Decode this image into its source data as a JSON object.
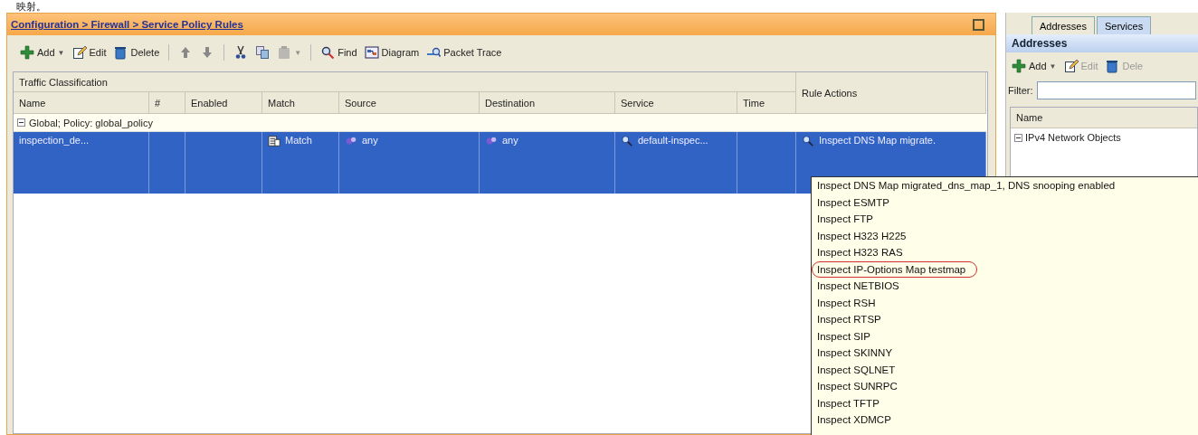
{
  "caption": "映射。",
  "panel": {
    "breadcrumb": "Configuration > Firewall > Service Policy Rules",
    "toolbar": [
      {
        "kind": "button",
        "label": "Add",
        "caret": "▼",
        "disabled": false
      },
      {
        "kind": "button",
        "label": "Edit",
        "disabled": false
      },
      {
        "kind": "button",
        "label": "Delete",
        "disabled": false
      },
      {
        "kind": "separator"
      },
      {
        "kind": "button",
        "disabled": false
      },
      {
        "kind": "button",
        "disabled": false
      },
      {
        "kind": "separator"
      },
      {
        "kind": "button",
        "disabled": false
      },
      {
        "kind": "button",
        "disabled": false
      },
      {
        "kind": "button",
        "caret": "▼",
        "disabled": true
      },
      {
        "kind": "separator"
      },
      {
        "kind": "button",
        "label": "Find",
        "disabled": false
      },
      {
        "kind": "button",
        "label": "Diagram",
        "disabled": false
      },
      {
        "kind": "button",
        "label": "Packet Trace",
        "disabled": false
      }
    ],
    "table": {
      "group_header": "Traffic Classification",
      "actions_header": "Rule Actions",
      "columns": [
        "Name",
        "#",
        "Enabled",
        "Match",
        "Source",
        "Destination",
        "Service",
        "Time"
      ],
      "group_row": {
        "label": "Global; Policy: global_policy",
        "expanded": true
      },
      "rows": [
        {
          "selected": true,
          "cells": [
            "inspection_de...",
            "",
            "",
            "Match",
            "any",
            "any",
            "default-inspec...",
            ""
          ],
          "action": "Inspect DNS Map migrate."
        }
      ]
    }
  },
  "tooltip": {
    "items": [
      {
        "text": "Inspect DNS Map migrated_dns_map_1, DNS snooping enabled",
        "highlighted": false
      },
      {
        "text": "Inspect ESMTP",
        "highlighted": false
      },
      {
        "text": "Inspect FTP",
        "highlighted": false
      },
      {
        "text": "Inspect H323 H225",
        "highlighted": false
      },
      {
        "text": "Inspect H323 RAS",
        "highlighted": false
      },
      {
        "text": "Inspect IP-Options Map testmap",
        "highlighted": true
      },
      {
        "text": "Inspect NETBIOS",
        "highlighted": false
      },
      {
        "text": "Inspect RSH",
        "highlighted": false
      },
      {
        "text": "Inspect RTSP",
        "highlighted": false
      },
      {
        "text": "Inspect SIP",
        "highlighted": false
      },
      {
        "text": "Inspect SKINNY",
        "highlighted": false
      },
      {
        "text": "Inspect SQLNET",
        "highlighted": false
      },
      {
        "text": "Inspect SUNRPC",
        "highlighted": false
      },
      {
        "text": "Inspect TFTP",
        "highlighted": false
      },
      {
        "text": "Inspect XDMCP",
        "highlighted": false
      }
    ]
  },
  "side": {
    "tabs": [
      {
        "label": "Addresses",
        "selected": true
      },
      {
        "label": "Services",
        "selected": false
      }
    ],
    "header": "Addresses",
    "toolbar": [
      {
        "label": "Add",
        "caret": "▼",
        "disabled": false
      },
      {
        "label": "Edit",
        "disabled": true
      },
      {
        "label": "Dele",
        "disabled": true
      }
    ],
    "filter_label": "Filter:",
    "column": "Name",
    "tree": [
      {
        "label": "IPv4 Network Objects",
        "expanded": true
      }
    ]
  }
}
